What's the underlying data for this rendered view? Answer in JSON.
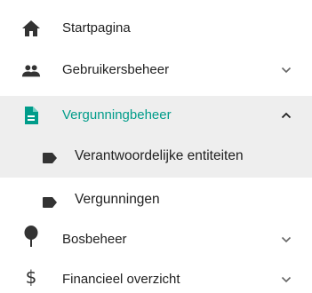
{
  "colors": {
    "accent": "#009c8a",
    "active_bg": "#eeeeee",
    "icon": "#333333",
    "chevron": "#666666"
  },
  "menu": [
    {
      "label": "Startpagina",
      "icon": "home-icon"
    },
    {
      "label": "Gebruikersbeheer",
      "icon": "users-icon",
      "expandable": true
    },
    {
      "label": "Vergunningbeheer",
      "icon": "document-icon",
      "expandable": true,
      "expanded": true,
      "children": [
        {
          "label": "Verantwoordelijke entiteiten",
          "icon": "label-icon",
          "selected": true
        },
        {
          "label": "Vergunningen",
          "icon": "label-icon"
        }
      ]
    },
    {
      "label": "Bosbeheer",
      "icon": "tree-icon",
      "expandable": true
    },
    {
      "label": "Financieel overzicht",
      "icon": "dollar-icon",
      "expandable": true
    }
  ],
  "glyphs": {
    "dollar": "$"
  }
}
